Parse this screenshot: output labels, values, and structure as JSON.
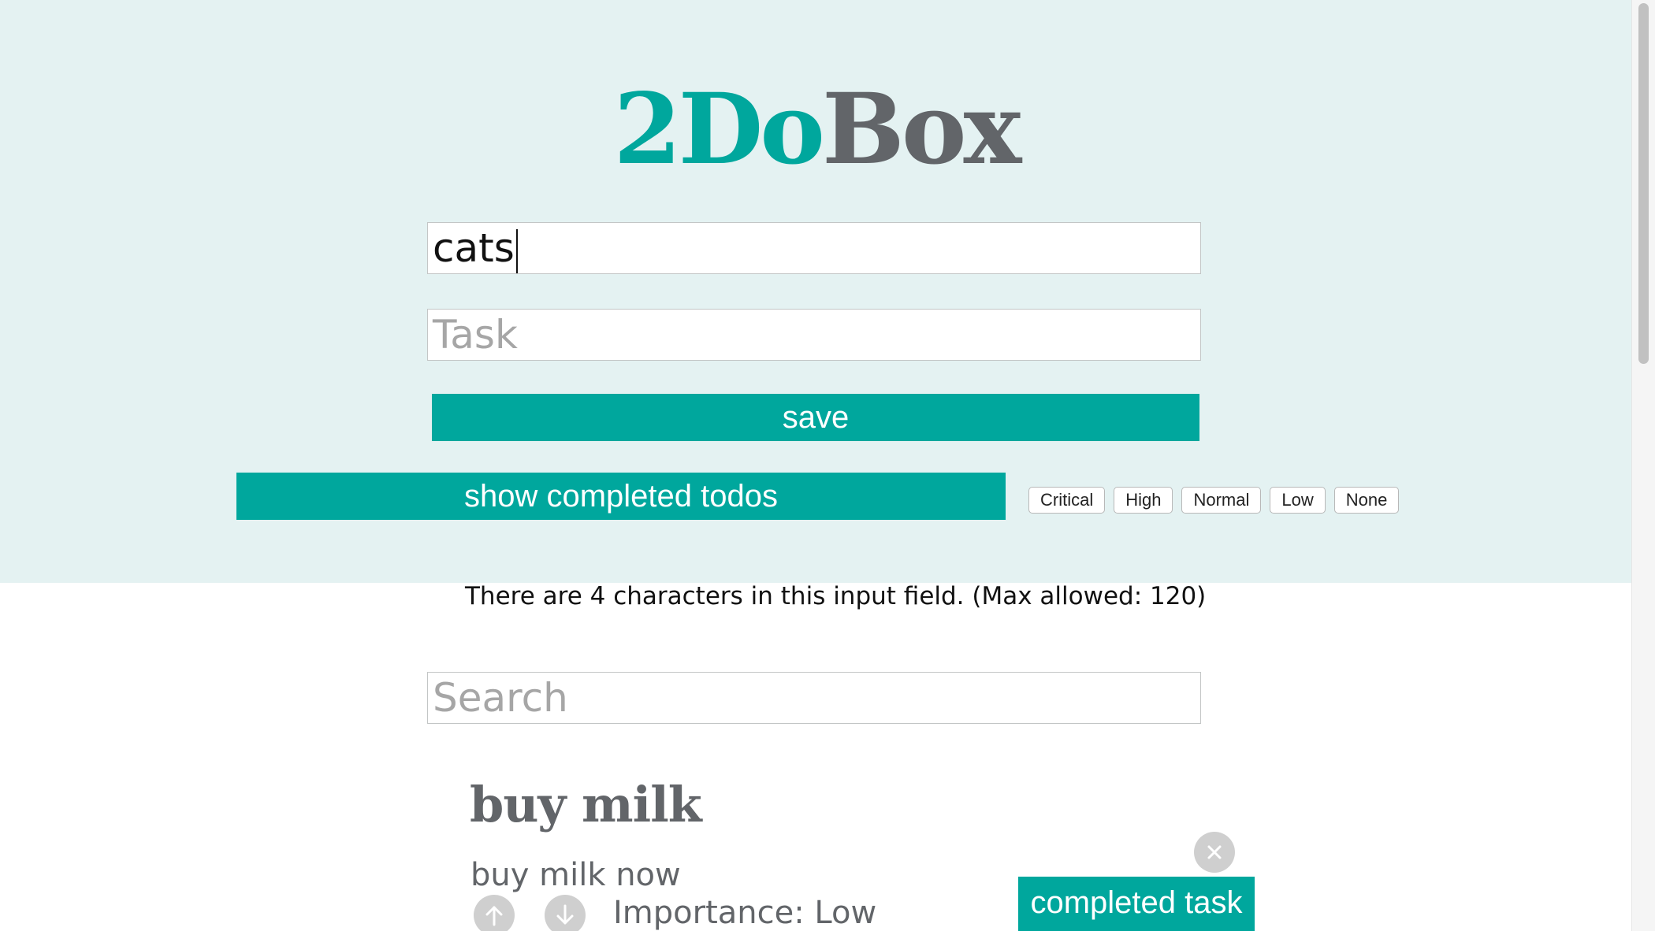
{
  "app": {
    "title_part1": "2Do",
    "title_part2": "Box"
  },
  "form": {
    "title_value": "cats",
    "task_placeholder": "Task",
    "save_label": "save"
  },
  "controls": {
    "show_completed_label": "show completed todos",
    "filters": [
      "Critical",
      "High",
      "Normal",
      "Low",
      "None"
    ]
  },
  "counter_text": "There are 4 characters in this input field. (Max allowed: 120)",
  "search": {
    "placeholder": "Search"
  },
  "todos": [
    {
      "title": "buy milk",
      "body": "buy milk now",
      "importance": "Importance: Low",
      "completed_label": "completed task"
    }
  ],
  "colors": {
    "accent": "#00a79d",
    "title_gray": "#626569",
    "header_bg": "#e4f2f2"
  },
  "icons": {
    "delete": "close-icon",
    "upvote": "arrow-up-icon",
    "downvote": "arrow-down-icon"
  }
}
